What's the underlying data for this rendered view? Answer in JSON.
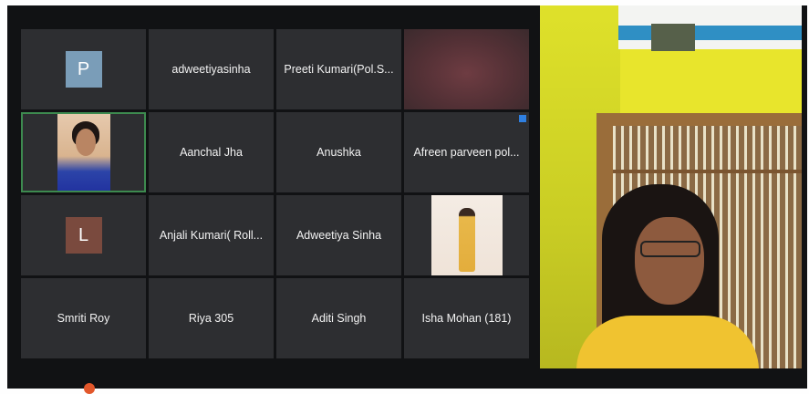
{
  "gallery": {
    "tiles": [
      {
        "type": "avatar",
        "letter": "P",
        "color": "#7a9db8"
      },
      {
        "type": "name",
        "label": "adweetiyasinha"
      },
      {
        "type": "name",
        "label": "Preeti Kumari(Pol.S..."
      },
      {
        "type": "video-blurred"
      },
      {
        "type": "video-pinned"
      },
      {
        "type": "name",
        "label": "Aanchal Jha"
      },
      {
        "type": "name",
        "label": "Anushka"
      },
      {
        "type": "name",
        "label": "Afreen parveen pol..."
      },
      {
        "type": "avatar",
        "letter": "L",
        "color": "#7a4a3e"
      },
      {
        "type": "name",
        "label": "Anjali Kumari( Roll..."
      },
      {
        "type": "name",
        "label": "Adweetiya Sinha"
      },
      {
        "type": "video-photo"
      },
      {
        "type": "name",
        "label": "Smriti Roy"
      },
      {
        "type": "name",
        "label": "Riya 305"
      },
      {
        "type": "name",
        "label": "Aditi Singh"
      },
      {
        "type": "name",
        "label": "Isha Mohan (181)"
      }
    ]
  },
  "colors": {
    "meeting_bg": "#111214",
    "tile_bg": "#2d2e31",
    "active_speaker_border": "#3d8a4f",
    "badge": "#2f7fe0"
  }
}
